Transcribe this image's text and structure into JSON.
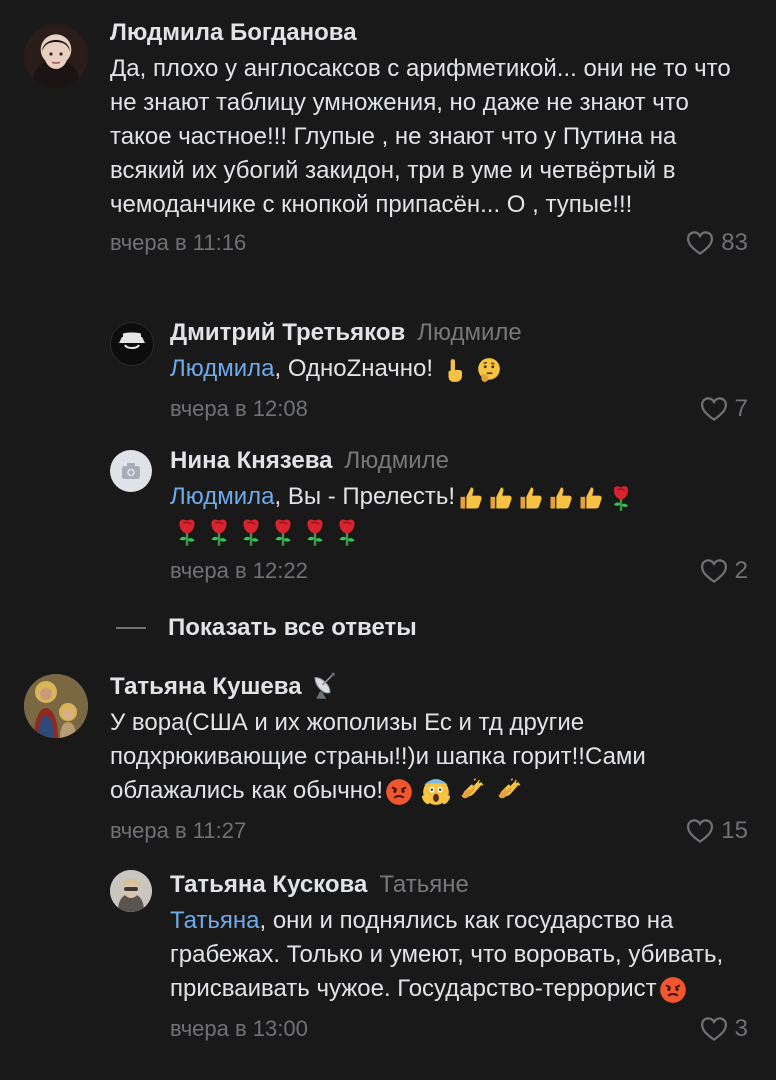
{
  "comments": [
    {
      "author": "Людмила Богданова",
      "text": "Да, плохо у англосаксов с арифметикой... они не то что не знают таблицу умножения, но даже не знают что такое частное!!! Глупые , не знают что у Путина на всякий их убогий закидон, три в уме и четвёртый в чемоданчике с кнопкой припасён... О , тупые!!!",
      "time": "вчера в 11:16",
      "likes": "83"
    },
    {
      "author": "Дмитрий Третьяков",
      "reply_to": "Людмиле",
      "mention": "Людмила",
      "text": ", ОдноZначно!",
      "time": "вчера в 12:08",
      "likes": "7"
    },
    {
      "author": "Нина Князева",
      "reply_to": "Людмиле",
      "mention": "Людмила",
      "text": ", Вы - Прелесть!",
      "time": "вчера в 12:22",
      "likes": "2"
    },
    {
      "author": "Татьяна Кушева",
      "text": "У вора(США и их жополизы Ес и  тд другие подхрюкивающие страны!!)и шапка горит!!Сами облажались как обычно!",
      "time": "вчера в 11:27",
      "likes": "15"
    },
    {
      "author": "Татьяна Кускова",
      "reply_to": "Татьяне",
      "mention": "Татьяна",
      "text": ", они и поднялись как государство на грабежах. Только и умеют, что воровать, убивать, присваивать чужое. Государство-террорист",
      "time": "вчера в 13:00",
      "likes": "3"
    }
  ],
  "show_all_replies": "Показать все ответы",
  "colors": {
    "background": "#19191a",
    "text": "#e1e3e6",
    "secondary": "#6f7175",
    "mention": "#71aaeb"
  },
  "icons": [
    "heart-icon",
    "camera-icon",
    "satellite-dish-icon",
    "thumbs-up-icon",
    "rose-icon",
    "angry-face-icon",
    "scream-face-icon",
    "clapping-hands-icon",
    "pointing-up-icon",
    "thinking-face-icon"
  ]
}
